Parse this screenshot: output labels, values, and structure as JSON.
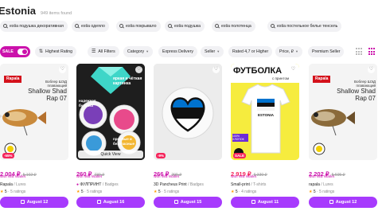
{
  "header": {
    "title": "Estonia",
    "count": "949 items found"
  },
  "chips": [
    "estia подушка декоративная",
    "estia одеяло",
    "estia покрывало",
    "estia подушка",
    "estia полотенца",
    "estia постельное белье тенсель"
  ],
  "filters": {
    "sale": "SALE",
    "sort": "Highest Rating",
    "all_filters": "All Filters",
    "category": "Category",
    "express": "Express Delivery",
    "seller": "Seller",
    "rated": "Rated 4,7 or Higher",
    "price": "Price, ₽",
    "premium": "Premium Seller"
  },
  "products": [
    {
      "badge": "-55%",
      "price": "2 004 ₽",
      "old_price": "5 102 ₽",
      "wallet": "with WB Wallet",
      "brand": "Rapala",
      "name": "Lures",
      "rating": "5",
      "reviews": "5 ratings",
      "cta": "August 12",
      "img": {
        "brand": "Rapala",
        "title": "Shallow Shad Rap 07",
        "subtitle": "Воблер ШЭД плавающий"
      }
    },
    {
      "badge": "",
      "price": "260 ₽",
      "old_price": "730 ₽",
      "wallet": "with WB Wallet",
      "brand": "ФУЛПРИНТ",
      "name": "Badges",
      "rating": "5",
      "reviews": "5 ratings",
      "cta": "August 16",
      "quickview": "Quick View",
      "img": {
        "t1": "яркая и чёткая картинка",
        "t2": "надежная булавка",
        "t3": "прочные и безопасные"
      }
    },
    {
      "badge": "-9%",
      "price": "266 ₽",
      "old_price": "299 ₽",
      "wallet": "with WB Wallet",
      "brand": "3D Pancheus Print",
      "name": "Badges",
      "rating": "5",
      "reviews": "5 ratings",
      "cta": "August 15",
      "img": {}
    },
    {
      "badge": "SALE",
      "price": "2 919 ₽",
      "old_price": "6 330 ₽",
      "wallet": "with WB Wallet",
      "brand": "Small-print",
      "name": "T-shirts",
      "rating": "5",
      "reviews": "4 ratings",
      "cta": "August 11",
      "img": {
        "title": "ФУТБОЛКА",
        "sub": "с принтом",
        "shirt_text": "ESTONIA",
        "side": "100% ХЛОПОК"
      }
    },
    {
      "badge": "",
      "price": "2 202 ₽",
      "old_price": "5 605 ₽",
      "wallet": "with WB Wallet",
      "brand": "rapala",
      "name": "Lures",
      "rating": "5",
      "reviews": "5 ratings",
      "cta": "August 12",
      "img": {
        "brand": "Rapala",
        "title": "Shallow Shad Rap 07",
        "subtitle": "Воблер ШЭД плавающий"
      }
    }
  ],
  "colors": {
    "accent": "#cb11ab",
    "cta": "#a73afd",
    "badge": "#f5245b",
    "estonia_blue": "#0072ce"
  }
}
